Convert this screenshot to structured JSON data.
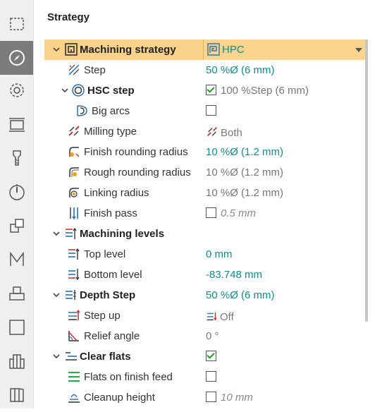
{
  "panel": {
    "title": "Strategy"
  },
  "toolbar": {
    "tools": [
      "selection-frame-icon",
      "compass-icon",
      "gear-icon",
      "level-frame-icon",
      "tool-icon",
      "dial-icon",
      "stacked-boxes-icon",
      "m-icon",
      "pedestal-icon",
      "square-icon",
      "columns-icon",
      "book-icon"
    ]
  },
  "rows": {
    "machining_strategy": {
      "label": "Machining strategy",
      "value": "HPC"
    },
    "step": {
      "label": "Step",
      "value": "50 %Ø (6 mm)"
    },
    "hsc_step": {
      "label": "HSC step",
      "value": "100 %Step (6 mm)"
    },
    "big_arcs": {
      "label": "Big arcs"
    },
    "milling_type": {
      "label": "Milling type",
      "value": "Both"
    },
    "finish_rounding_radius": {
      "label": "Finish rounding radius",
      "value": "10 %Ø (1.2 mm)"
    },
    "rough_rounding_radius": {
      "label": "Rough rounding radius",
      "value": "10 %Ø (1.2 mm)"
    },
    "linking_radius": {
      "label": "Linking radius",
      "value": "10 %Ø (1.2 mm)"
    },
    "finish_pass": {
      "label": "Finish pass",
      "value": "0.5 mm"
    },
    "machining_levels": {
      "label": "Machining levels"
    },
    "top_level": {
      "label": "Top level",
      "value": "0 mm"
    },
    "bottom_level": {
      "label": "Bottom level",
      "value": "-83.748 mm"
    },
    "depth_step": {
      "label": "Depth Step",
      "value": "50 %Ø (6 mm)"
    },
    "step_up": {
      "label": "Step up",
      "value": "Off"
    },
    "relief_angle": {
      "label": "Relief angle",
      "value": "0 °"
    },
    "clear_flats": {
      "label": "Clear flats"
    },
    "flats_on_finish_feed": {
      "label": "Flats on finish feed"
    },
    "cleanup_height": {
      "label": "Cleanup height",
      "value": "10 mm"
    }
  },
  "colors": {
    "selected_row": "#fad28a",
    "value_teal": "#148a8a",
    "toolbar_bg": "#efefef",
    "active_tool": "#7b7b7b"
  }
}
